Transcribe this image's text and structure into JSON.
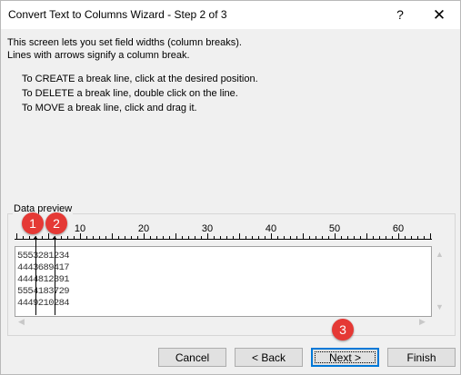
{
  "window": {
    "title": "Convert Text to Columns Wizard - Step 2 of 3",
    "help_label": "?",
    "close_label": "✕"
  },
  "description": {
    "line1": "This screen lets you set field widths (column breaks).",
    "line2": "Lines with arrows signify a column break."
  },
  "instructions": [
    "To CREATE a break line, click at the desired position.",
    "To DELETE a break line, double click on the line.",
    "To MOVE a break line, click and drag it."
  ],
  "preview": {
    "label": "Data preview",
    "ruler_labels": [
      "10",
      "20",
      "30",
      "40",
      "50",
      "60"
    ],
    "rows": [
      "5553281234",
      "4443689417",
      "4444812391",
      "5554183729",
      "4449210284"
    ],
    "break_positions": [
      3,
      6
    ]
  },
  "badges": [
    "1",
    "2",
    "3"
  ],
  "buttons": {
    "cancel": "Cancel",
    "back": "< Back",
    "next": "Next >",
    "finish": "Finish"
  }
}
